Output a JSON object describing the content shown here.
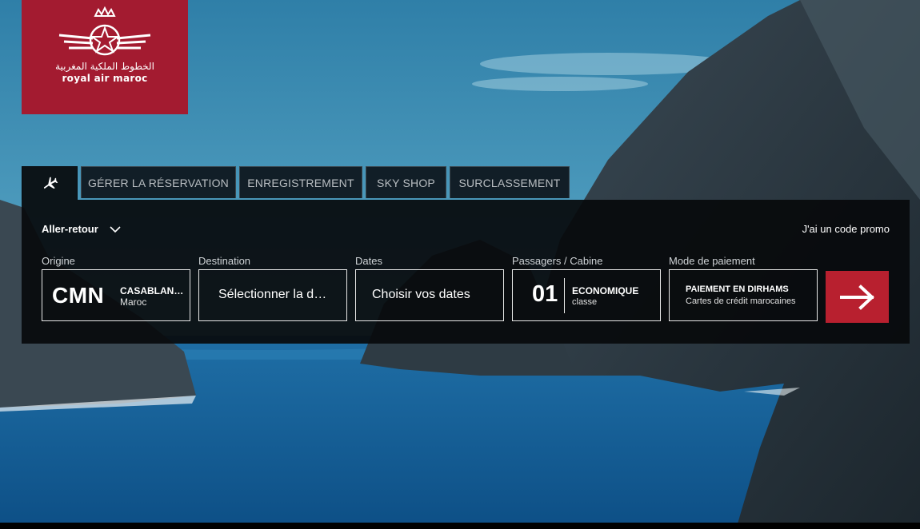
{
  "brand": {
    "arabic_name": "الخطوط الملكية المغربية",
    "name": "royal air maroc",
    "color": "#a31b30"
  },
  "tabs": [
    {
      "icon": "airplane-icon",
      "label": ""
    },
    {
      "label": "GÉRER LA RÉSERVATION"
    },
    {
      "label": "ENREGISTREMENT"
    },
    {
      "label": "SKY SHOP"
    },
    {
      "label": "SURCLASSEMENT"
    }
  ],
  "booking": {
    "trip_type": "Aller-retour",
    "promo_link": "J'ai un code promo",
    "origin": {
      "label": "Origine",
      "code": "CMN",
      "city": "CASABLANCA",
      "country": "Maroc"
    },
    "destination": {
      "label": "Destination",
      "placeholder": "Sélectionner la destination"
    },
    "dates": {
      "label": "Dates",
      "placeholder": "Choisir vos dates"
    },
    "passengers": {
      "label": "Passagers / Cabine",
      "count": "01",
      "cabin": "ECONOMIQUE",
      "cabin_sub": "classe"
    },
    "payment": {
      "label": "Mode de paiement",
      "title": "PAIEMENT EN DIRHAMS",
      "subtitle": "Cartes de crédit marocaines"
    },
    "search_button_icon": "arrow-right-icon",
    "accent_color": "#b8202f"
  }
}
